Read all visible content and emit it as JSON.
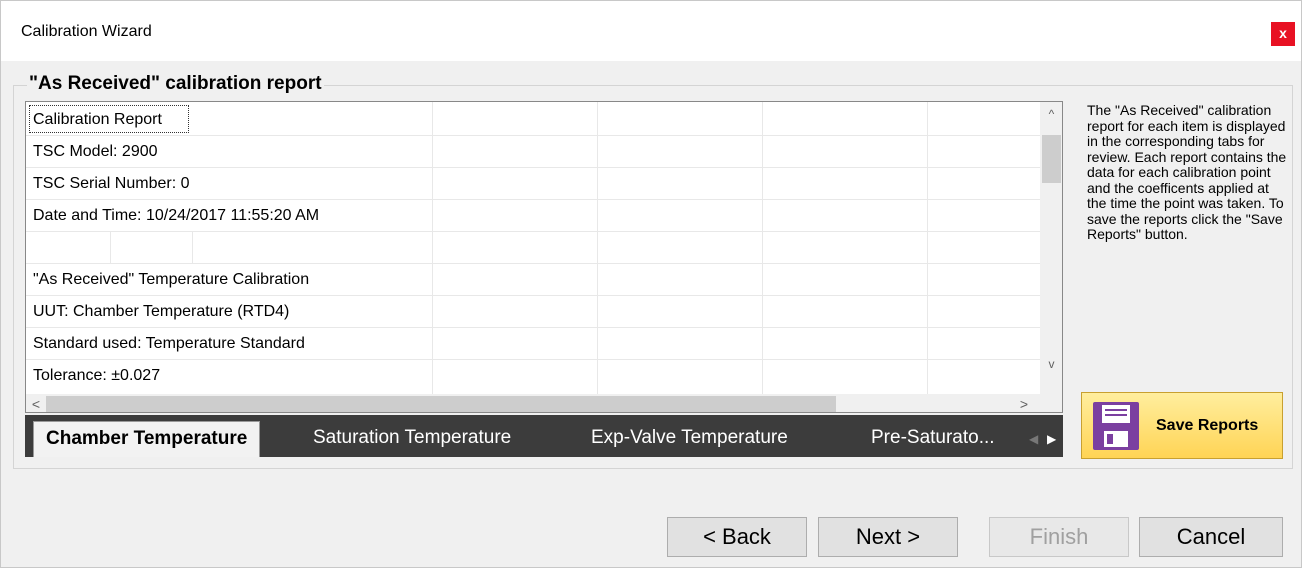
{
  "window": {
    "title": "Calibration Wizard",
    "close_label": "x"
  },
  "group": {
    "title": "\"As Received\" calibration report"
  },
  "report": {
    "rows": [
      "Calibration Report",
      "TSC Model: 2900",
      "TSC Serial Number: 0",
      "Date and Time: 10/24/2017 11:55:20 AM",
      "",
      "\"As Received\" Temperature Calibration",
      "UUT: Chamber Temperature (RTD4)",
      "Standard used: Temperature Standard",
      "Tolerance: ±0.027"
    ],
    "scroll_up": "^",
    "scroll_down": "v",
    "scroll_left": "<",
    "scroll_right": ">"
  },
  "tabs": [
    {
      "label": "Chamber Temperature",
      "active": true
    },
    {
      "label": "Saturation Temperature",
      "active": false
    },
    {
      "label": "Exp-Valve Temperature",
      "active": false
    },
    {
      "label": "Pre-Saturato...",
      "active": false
    }
  ],
  "tab_nav": {
    "prev": "◀",
    "next": "▶"
  },
  "help_text": "The \"As Received\" calibration report for each item is displayed in the corresponding tabs for review.  Each report contains the data for each calibration point and the coefficents applied at the time the point was taken.  To save the reports click the \"Save Reports\" button.",
  "save_button": {
    "label": "Save Reports",
    "icon": "floppy-disk-icon"
  },
  "footer_buttons": {
    "back": "< Back",
    "next": "Next >",
    "finish": "Finish",
    "cancel": "Cancel"
  },
  "colors": {
    "close": "#e81123",
    "tabbar": "#3c3c3c",
    "save_button": "#ffd455",
    "floppy": "#7b3fa0"
  }
}
